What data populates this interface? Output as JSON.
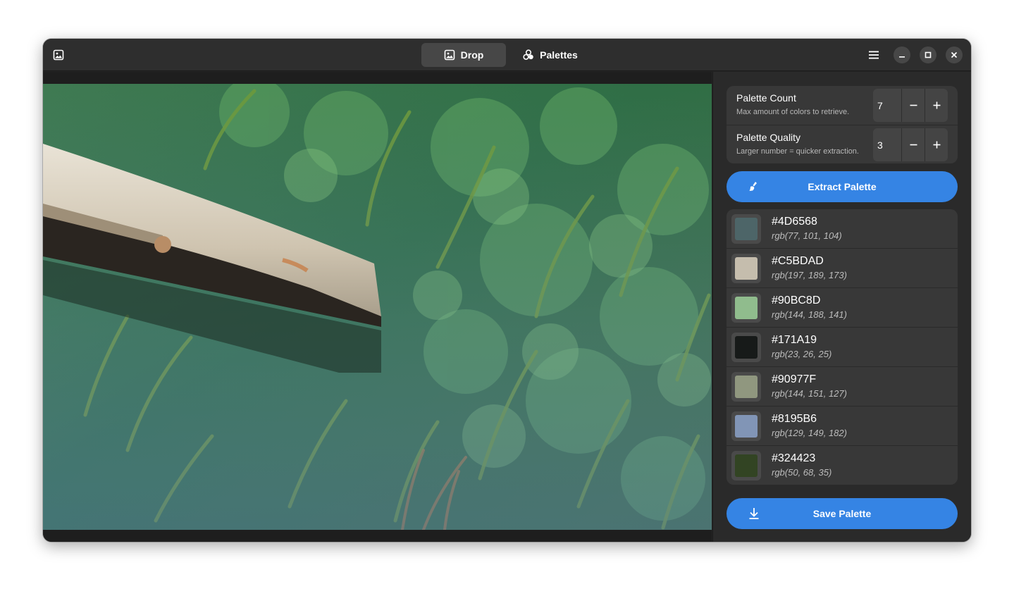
{
  "tabs": [
    {
      "label": "Drop",
      "icon": "image-icon",
      "active": true
    },
    {
      "label": "Palettes",
      "icon": "palette-icon",
      "active": false
    }
  ],
  "settings": {
    "count": {
      "title": "Palette Count",
      "subtitle": "Max amount of colors to retrieve.",
      "value": "7"
    },
    "quality": {
      "title": "Palette Quality",
      "subtitle": "Larger number = quicker extraction.",
      "value": "3"
    }
  },
  "buttons": {
    "extract_label": "Extract Palette",
    "save_label": "Save Palette"
  },
  "palette": [
    {
      "hex": "#4D6568",
      "rgb": "rgb(77, 101, 104)"
    },
    {
      "hex": "#C5BDAD",
      "rgb": "rgb(197, 189, 173)"
    },
    {
      "hex": "#90BC8D",
      "rgb": "rgb(144, 188, 141)"
    },
    {
      "hex": "#171A19",
      "rgb": "rgb(23, 26, 25)"
    },
    {
      "hex": "#90977F",
      "rgb": "rgb(144, 151, 127)"
    },
    {
      "hex": "#8195B6",
      "rgb": "rgb(129, 149, 182)"
    },
    {
      "hex": "#324423",
      "rgb": "rgb(50, 68, 35)"
    }
  ],
  "colors": {
    "accent": "#3584e4",
    "window_bg": "#242424",
    "headerbar_bg": "#2e2e2e",
    "card_bg": "#383838"
  }
}
